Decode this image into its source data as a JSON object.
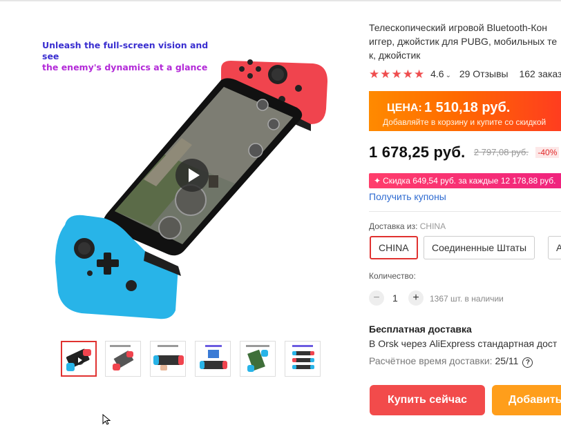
{
  "gallery": {
    "promo_line1": "Unleash the full-screen vision and see",
    "promo_line2": "the enemy's dynamics at a glance",
    "thumbnail_count": 6,
    "active_thumbnail": 1
  },
  "product": {
    "title_line1": "Телескопический игровой Bluetooth-Кон",
    "title_line2": "иггер, джойстик для PUBG, мобильных те",
    "title_line3": "к, джойстик",
    "rating_stars": "★★★★★",
    "rating_value": "4.6",
    "reviews": "29 Отзывы",
    "orders": "162 заказ"
  },
  "price_banner": {
    "label": "ЦЕНА:",
    "price": "1 510,18 руб.",
    "subtitle": "Добавляйте в корзину и купите со скидкой"
  },
  "pricing": {
    "current": "1 678,25 руб.",
    "old": "2 797,08 руб.",
    "discount": "-40%",
    "promo": "Скидка 649,54 руб. за каждые 12 178,88 руб.",
    "coupons_link": "Получить купоны"
  },
  "shipping": {
    "from_label": "Доставка из:",
    "from_value": "CHINA",
    "options": [
      "CHINA",
      "Соединенные Штаты",
      "A"
    ],
    "selected": "CHINA"
  },
  "quantity": {
    "label": "Количество:",
    "minus": "−",
    "value": "1",
    "plus": "+",
    "stock": "1367 шт. в наличии"
  },
  "delivery": {
    "title": "Бесплатная доставка",
    "route": "В Orsk через AliExpress стандартная дост",
    "time_label": "Расчётное время доставки:",
    "time_value": "25/11"
  },
  "actions": {
    "buy_now": "Купить сейчас",
    "add_to_cart": "Добавить"
  },
  "colors": {
    "accent_red": "#f24b4b",
    "banner_orange": "#ff6a00",
    "add_cart_orange": "#ff9e1b",
    "link_blue": "#2e6bd1",
    "star_red": "#ef4d4e",
    "controller_red": "#f0444e",
    "controller_blue": "#28b4e8"
  }
}
